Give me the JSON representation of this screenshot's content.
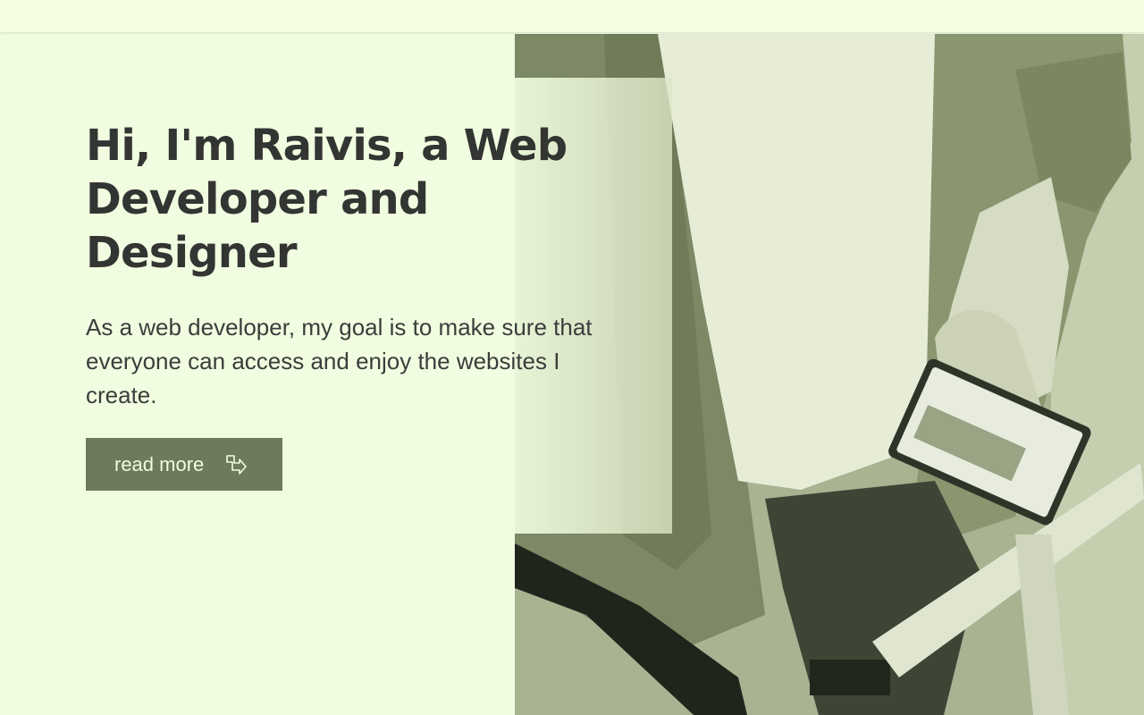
{
  "hero": {
    "headline": "Hi, I'm Raivis, a Web Developer and Designer",
    "description": "As a web developer, my goal is to make sure that everyone can access and enjoy the websites I create.",
    "cta_label": "read more",
    "cta_icon": "arrow-down-right-icon"
  },
  "image": {
    "subject": "person-holding-phone-with-bicycle"
  },
  "colors": {
    "background": "#f1fde0",
    "heading": "#333533",
    "button": "#6b7b5c",
    "button_text": "#f1fde0"
  }
}
